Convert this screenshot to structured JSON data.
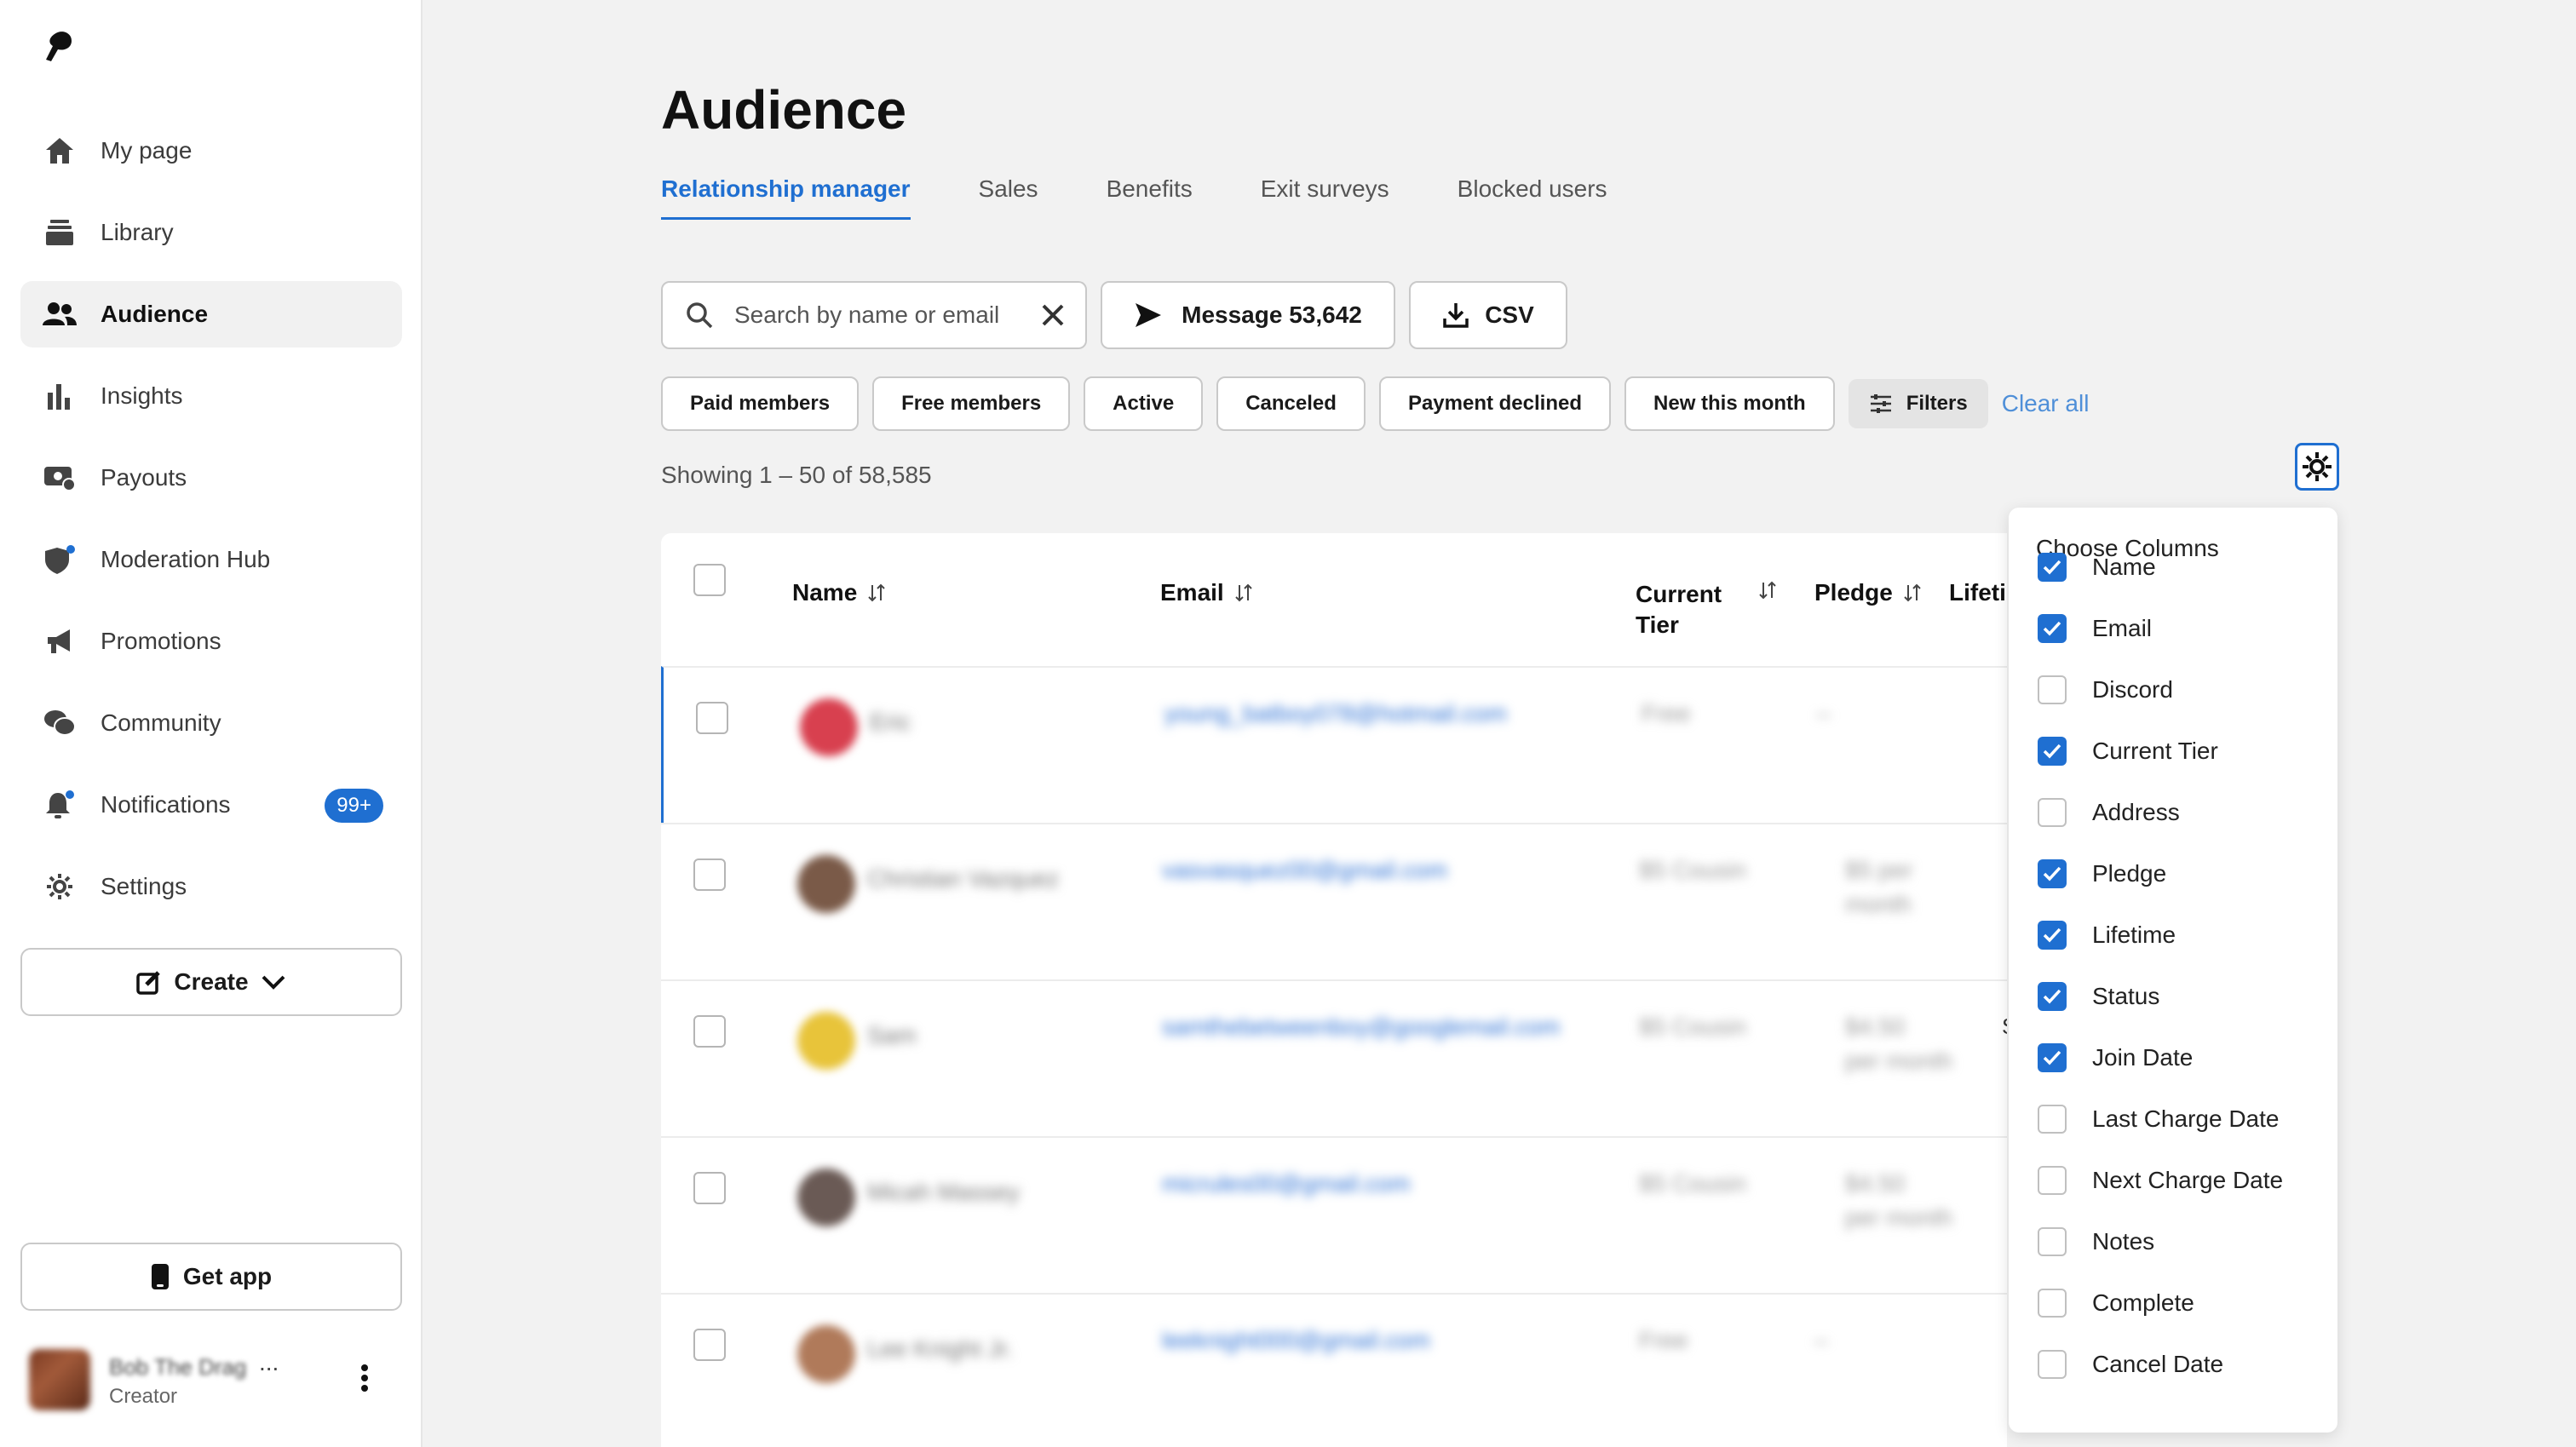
{
  "sidebar": {
    "items": [
      {
        "label": "My page",
        "icon": "home-icon"
      },
      {
        "label": "Library",
        "icon": "library-icon"
      },
      {
        "label": "Audience",
        "icon": "people-icon",
        "active": true
      },
      {
        "label": "Insights",
        "icon": "bar-chart-icon"
      },
      {
        "label": "Payouts",
        "icon": "payouts-icon"
      },
      {
        "label": "Moderation Hub",
        "icon": "shield-icon"
      },
      {
        "label": "Promotions",
        "icon": "megaphone-icon"
      },
      {
        "label": "Community",
        "icon": "chat-bubbles-icon"
      },
      {
        "label": "Notifications",
        "icon": "bell-icon",
        "badge": "99+"
      },
      {
        "label": "Settings",
        "icon": "gear-icon"
      }
    ],
    "create_label": "Create",
    "get_app_label": "Get app",
    "profile": {
      "name": "Bob The Drag",
      "ellipsis": "...",
      "role": "Creator"
    }
  },
  "main": {
    "title": "Audience",
    "tabs": [
      "Relationship manager",
      "Sales",
      "Benefits",
      "Exit surveys",
      "Blocked users"
    ],
    "active_tab": "Relationship manager",
    "search": {
      "placeholder": "Search by name or email"
    },
    "message_button": "Message 53,642",
    "csv_button": "CSV",
    "filter_chips": [
      "Paid members",
      "Free members",
      "Active",
      "Canceled",
      "Payment declined",
      "New this month"
    ],
    "filters_label": "Filters",
    "clear_all": "Clear all",
    "showing": "Showing 1 – 50 of 58,585"
  },
  "table": {
    "headers": {
      "name": "Name",
      "email": "Email",
      "tier_line1": "Current",
      "tier_line2": "Tier",
      "pledge": "Pledge",
      "lifetime": "Lifetir"
    },
    "rows": [
      {
        "name": "Eric",
        "email": "young_batboy078@hotmail.com",
        "tier": "Free",
        "pledge": "–",
        "pledge2": ""
      },
      {
        "name": "Christian Vazquez",
        "email": "vasvasquez00@gmail.com",
        "tier": "$5 Cousin",
        "pledge": "$5 per",
        "pledge2": "month"
      },
      {
        "name": "Sam",
        "email": "samthebetweenboy@googlemail.com",
        "tier": "$5 Cousin",
        "pledge": "$4.50",
        "pledge2": "per month"
      },
      {
        "name": "Micah Massey",
        "email": "micrules00@gmail.com",
        "tier": "$5 Cousin",
        "pledge": "$4.50",
        "pledge2": "per month"
      },
      {
        "name": "Lee Knight Jr.",
        "email": "leeknight000@gmail.com",
        "tier": "Free",
        "pledge": "–",
        "pledge2": ""
      }
    ],
    "row3_partial": "S"
  },
  "column_chooser": {
    "title": "Choose Columns",
    "options": [
      {
        "label": "Name",
        "checked": true
      },
      {
        "label": "Email",
        "checked": true
      },
      {
        "label": "Discord",
        "checked": false
      },
      {
        "label": "Current Tier",
        "checked": true
      },
      {
        "label": "Address",
        "checked": false
      },
      {
        "label": "Pledge",
        "checked": true
      },
      {
        "label": "Lifetime",
        "checked": true
      },
      {
        "label": "Status",
        "checked": true
      },
      {
        "label": "Join Date",
        "checked": true
      },
      {
        "label": "Last Charge Date",
        "checked": false
      },
      {
        "label": "Next Charge Date",
        "checked": false
      },
      {
        "label": "Notes",
        "checked": false
      },
      {
        "label": "Complete",
        "checked": false
      },
      {
        "label": "Cancel Date",
        "checked": false
      }
    ]
  },
  "colors": {
    "accent": "#1f6fd1",
    "link_light": "#4f8fd8",
    "background": "#f2f2f2"
  }
}
